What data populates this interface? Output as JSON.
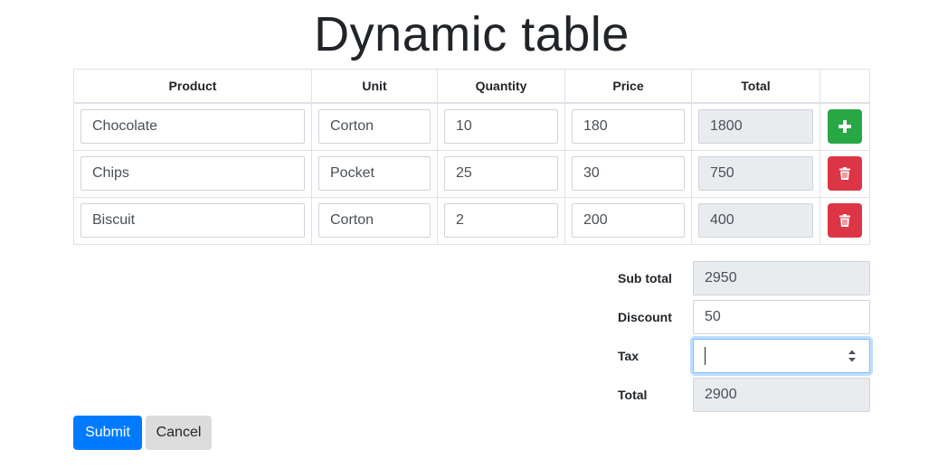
{
  "page": {
    "title": "Dynamic table"
  },
  "table": {
    "headers": [
      "Product",
      "Unit",
      "Quantity",
      "Price",
      "Total"
    ],
    "rows": [
      {
        "product": "Chocolate",
        "unit": "Corton",
        "quantity": "10",
        "price": "180",
        "total": "1800",
        "action": "plus-icon"
      },
      {
        "product": "Chips",
        "unit": "Pocket",
        "quantity": "25",
        "price": "30",
        "total": "750",
        "action": "trash-icon"
      },
      {
        "product": "Biscuit",
        "unit": "Corton",
        "quantity": "2",
        "price": "200",
        "total": "400",
        "action": "trash-icon"
      }
    ]
  },
  "summary": {
    "subtotal_label": "Sub total",
    "subtotal_value": "2950",
    "discount_label": "Discount",
    "discount_value": "50",
    "tax_label": "Tax",
    "tax_value": "",
    "total_label": "Total",
    "total_value": "2900"
  },
  "buttons": {
    "submit_label": "Submit",
    "cancel_label": "Cancel"
  },
  "colors": {
    "add": "#28a745",
    "delete": "#dc3545",
    "primary": "#007bff",
    "readonly_bg": "#e9ecef"
  }
}
